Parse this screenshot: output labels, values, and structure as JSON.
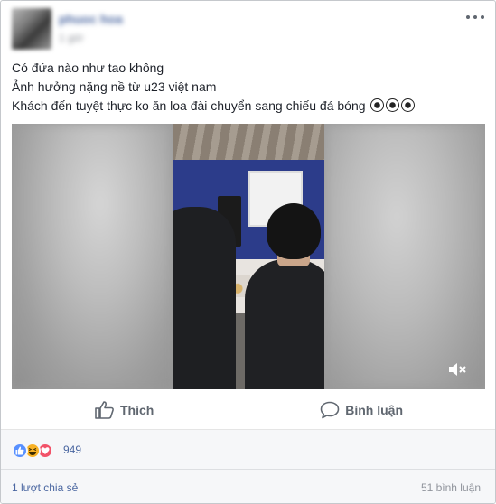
{
  "post": {
    "author_name": "phuoc hoa",
    "timestamp": "1 giờ",
    "more_icon": "more-dots-icon",
    "text_lines": [
      "Có đứa nào như tao không",
      "Ảnh hưởng nặng nề từ u23 việt nam",
      "Khách đến tuyệt thực ko ăn loa đài chuyển sang chiếu đá bóng"
    ],
    "text_emoji": "soccer-ball-icon"
  },
  "video": {
    "muted": true,
    "mute_icon": "volume-muted-icon"
  },
  "actions": {
    "like_label": "Thích",
    "like_icon": "thumbs-up-icon",
    "comment_label": "Bình luận",
    "comment_icon": "comment-bubble-icon"
  },
  "reactions": {
    "icons": [
      "like-icon",
      "haha-icon",
      "love-icon"
    ],
    "count": "949"
  },
  "footer": {
    "shares": "1 lượt chia sẻ",
    "comments": "51 bình luận"
  },
  "colors": {
    "link": "#4b67a1",
    "like_blue": "#5890ff",
    "haha_yellow": "#f7b125",
    "love_red": "#f25268"
  }
}
